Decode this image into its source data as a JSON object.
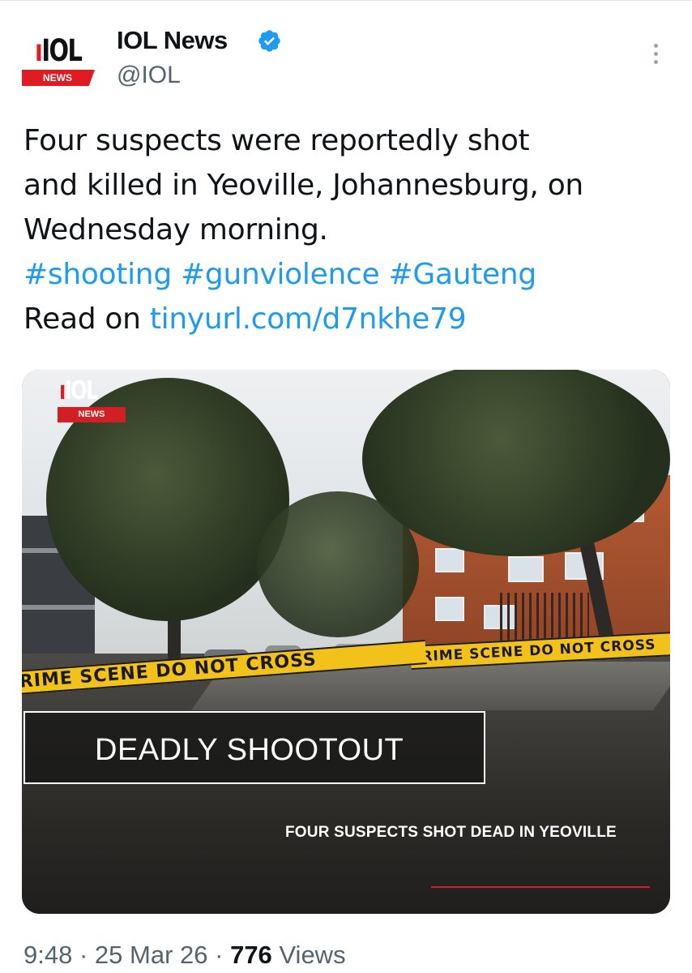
{
  "tweet": {
    "author": {
      "name": "IOL News",
      "handle": "@IOL",
      "verified": true,
      "avatar_logo": "IOL",
      "avatar_banner": "NEWS"
    },
    "text_lines": [
      "Four suspects were reportedly shot",
      "and killed in Yeoville, Johannesburg, on",
      "Wednesday morning."
    ],
    "hashtags": [
      "#shooting",
      "#gunviolence",
      "#Gauteng"
    ],
    "read_on_label": "Read on",
    "link": "tinyurl.com/d7nkhe79",
    "more_icon": "more-vertical-icon",
    "verified_icon": "verified-badge-icon"
  },
  "media": {
    "logo_text": "IOL",
    "logo_banner": "NEWS",
    "tape_text_front": "CRIME SCENE DO NOT CROSS",
    "tape_text_back": "CRIME SCENE DO NOT CROSS",
    "headline": "DEADLY SHOOTOUT",
    "subheadline": "FOUR SUSPECTS SHOT DEAD IN YEOVILLE"
  },
  "footer": {
    "time": "9:48",
    "separator": "·",
    "date": "25 Mar 26",
    "views_count": "776",
    "views_label": "Views"
  },
  "colors": {
    "link": "#1d9bf0",
    "verified": "#1d9bf0",
    "brand_red": "#e11b22",
    "text": "#0f1419",
    "secondary_text": "#536471"
  }
}
